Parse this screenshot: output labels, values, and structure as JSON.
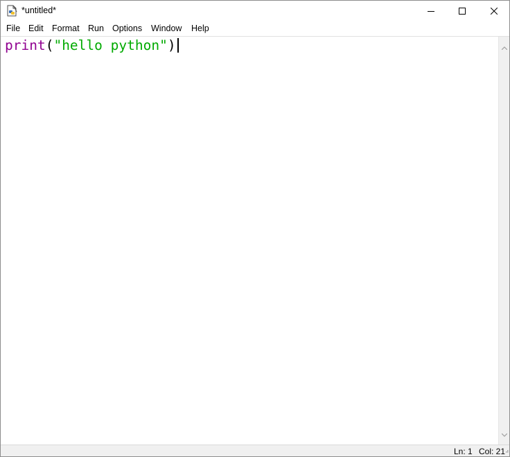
{
  "window": {
    "title": "*untitled*",
    "icon": "idle-editor-icon",
    "controls": [
      "minimize-icon",
      "maximize-icon",
      "close-icon"
    ]
  },
  "menubar": {
    "items": [
      {
        "label": "File"
      },
      {
        "label": "Edit"
      },
      {
        "label": "Format"
      },
      {
        "label": "Run"
      },
      {
        "label": "Options"
      },
      {
        "label": "Window"
      },
      {
        "label": "Help"
      }
    ]
  },
  "editor": {
    "code": {
      "builtin": "print",
      "open_paren": "(",
      "string": "\"hello python\"",
      "close_paren": ")"
    },
    "colors": {
      "builtin": "#900090",
      "string": "#00aa00",
      "default": "#000000"
    }
  },
  "statusbar": {
    "line": "Ln: 1",
    "column": "Col: 21"
  }
}
